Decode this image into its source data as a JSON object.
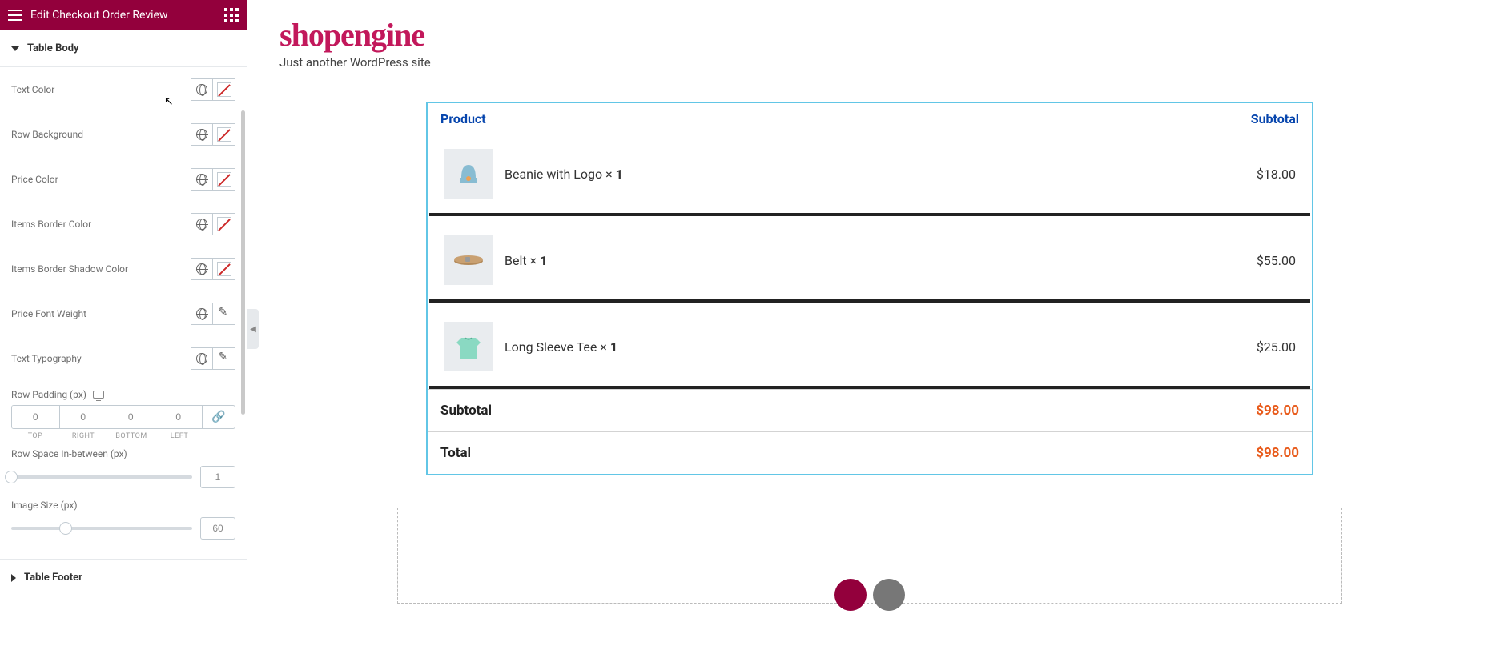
{
  "header": {
    "title": "Edit Checkout Order Review"
  },
  "sections": {
    "tableBody": "Table Body",
    "tableFooter": "Table Footer"
  },
  "controls": {
    "textColor": "Text Color",
    "rowBackground": "Row Background",
    "priceColor": "Price Color",
    "itemsBorderColor": "Items Border Color",
    "itemsBorderShadowColor": "Items Border Shadow Color",
    "priceFontWeight": "Price Font Weight",
    "textTypography": "Text Typography",
    "rowPadding": "Row Padding (px)",
    "rowSpace": "Row Space In-between (px)",
    "imageSize": "Image Size (px)"
  },
  "padding": {
    "top": "0",
    "right": "0",
    "bottom": "0",
    "left": "0",
    "labels": {
      "top": "TOP",
      "right": "RIGHT",
      "bottom": "BOTTOM",
      "left": "LEFT"
    }
  },
  "rowSpaceVal": "1",
  "imageSizeVal": "60",
  "site": {
    "title": "shopengine",
    "tagline": "Just another WordPress site"
  },
  "table": {
    "colProduct": "Product",
    "colSubtotal": "Subtotal",
    "items": [
      {
        "name": "Beanie with Logo",
        "qty": "1",
        "price": "$18.00"
      },
      {
        "name": "Belt",
        "qty": "1",
        "price": "$55.00"
      },
      {
        "name": "Long Sleeve Tee",
        "qty": "1",
        "price": "$25.00"
      }
    ],
    "subtotalLabel": "Subtotal",
    "subtotalValue": "$98.00",
    "totalLabel": "Total",
    "totalValue": "$98.00"
  }
}
